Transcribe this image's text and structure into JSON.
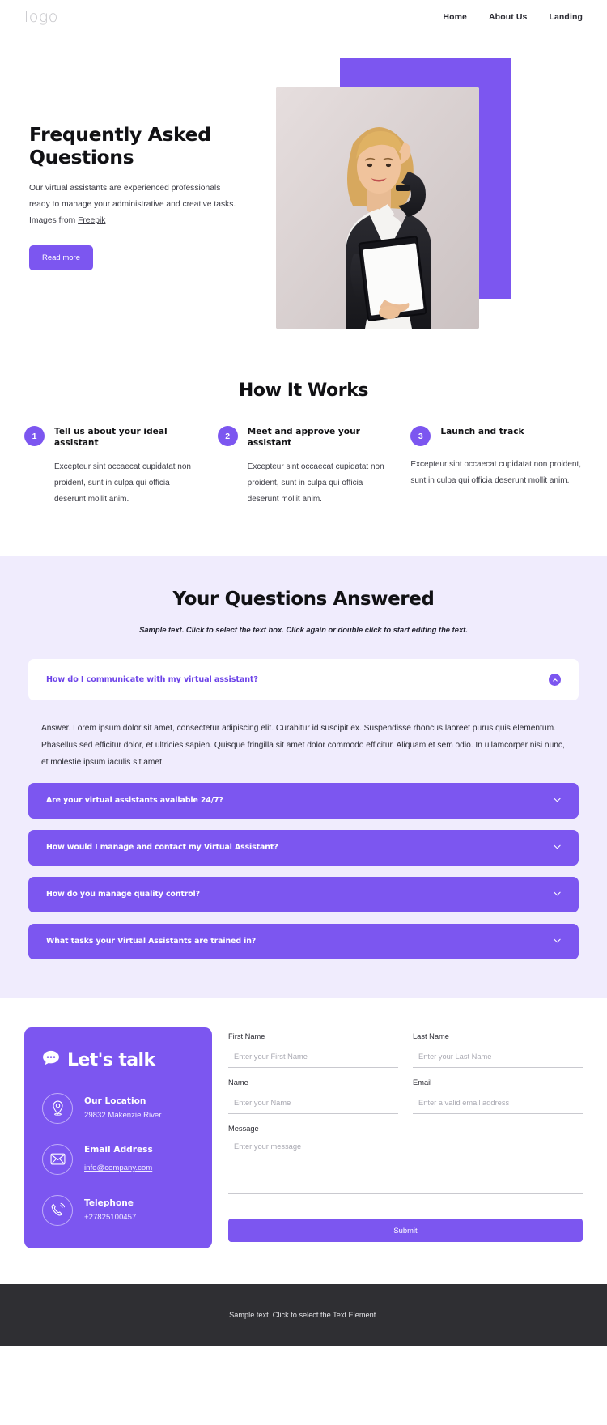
{
  "header": {
    "logo": "logo",
    "nav": [
      {
        "label": "Home"
      },
      {
        "label": "About Us"
      },
      {
        "label": "Landing"
      }
    ]
  },
  "hero": {
    "title": "Frequently Asked Questions",
    "paragraph_line1": "Our virtual assistants are experienced professionals",
    "paragraph_line2": "ready to manage your administrative and creative tasks.",
    "paragraph_line3_prefix": "Images from ",
    "credit_link": "Freepik",
    "button_label": "Read more",
    "accent_color": "#7c56f0",
    "image_alt": "businesswoman on phone holding folder"
  },
  "how_it_works": {
    "title": "How It Works",
    "steps": [
      {
        "number": "1",
        "title": "Tell us about your ideal assistant",
        "body": "Excepteur sint occaecat cupidatat non proident, sunt in culpa qui officia deserunt mollit anim."
      },
      {
        "number": "2",
        "title": "Meet and approve your assistant",
        "body": "Excepteur sint occaecat cupidatat non proident, sunt in culpa qui officia deserunt mollit anim."
      },
      {
        "number": "3",
        "title": "Launch and track",
        "body": "Excepteur sint occaecat cupidatat non proident, sunt in culpa qui officia deserunt mollit anim."
      }
    ]
  },
  "faq": {
    "title": "Your Questions Answered",
    "subtitle": "Sample text. Click to select the text box. Click again or double click to start editing the text.",
    "open_item": {
      "question": "How do I communicate with my virtual assistant?",
      "answer": "Answer. Lorem ipsum dolor sit amet, consectetur adipiscing elit. Curabitur id suscipit ex. Suspendisse rhoncus laoreet purus quis elementum. Phasellus sed efficitur dolor, et ultricies sapien. Quisque fringilla sit amet dolor commodo efficitur. Aliquam et sem odio. In ullamcorper nisi nunc, et molestie ipsum iaculis sit amet.",
      "icon": "chevron-up-circle-icon"
    },
    "closed_items": [
      {
        "question": "Are your virtual assistants available 24/7?",
        "icon": "chevron-down-icon"
      },
      {
        "question": "How would I manage and contact my Virtual Assistant?",
        "icon": "chevron-down-icon"
      },
      {
        "question": "How do you manage quality control?",
        "icon": "chevron-down-icon"
      },
      {
        "question": "What tasks your Virtual Assistants are trained in?",
        "icon": "chevron-down-icon"
      }
    ],
    "background_color": "#f0ecfd",
    "row_color": "#7c56f0"
  },
  "contact": {
    "talk_title": "Let's talk",
    "talk_icon": "chat-bubble-icon",
    "items": [
      {
        "icon": "map-pin-icon",
        "label": "Our Location",
        "value": "29832 Makenzie River",
        "is_link": false
      },
      {
        "icon": "envelope-icon",
        "label": "Email Address",
        "value": "info@company.com",
        "is_link": true
      },
      {
        "icon": "phone-icon",
        "label": "Telephone",
        "value": "+27825100457",
        "is_link": false
      }
    ],
    "form": {
      "fields": [
        {
          "label": "First Name",
          "placeholder": "Enter your First Name",
          "value": ""
        },
        {
          "label": "Last Name",
          "placeholder": "Enter your Last Name",
          "value": ""
        },
        {
          "label": "Name",
          "placeholder": "Enter your Name",
          "value": ""
        },
        {
          "label": "Email",
          "placeholder": "Enter a valid email address",
          "value": ""
        }
      ],
      "message_label": "Message",
      "message_placeholder": "Enter your message",
      "message_value": "",
      "submit_label": "Submit"
    }
  },
  "footer": {
    "text": "Sample text. Click to select the Text Element."
  }
}
